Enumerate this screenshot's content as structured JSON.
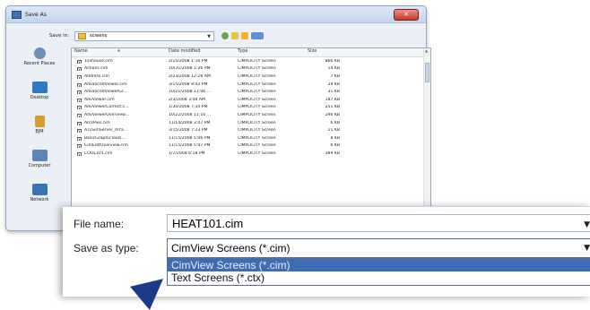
{
  "window": {
    "title": "Save As"
  },
  "save_in": {
    "label": "Save in:",
    "folder": "screens"
  },
  "places": [
    {
      "label": "Recent Places",
      "icon": "recent-places-icon",
      "color": "#6b8fb8"
    },
    {
      "label": "Desktop",
      "icon": "desktop-icon",
      "color": "#2f78c4"
    },
    {
      "label": "BJM",
      "icon": "user-folder-icon",
      "color": "#d79b2e"
    },
    {
      "label": "Computer",
      "icon": "computer-icon",
      "color": "#5c86b8"
    },
    {
      "label": "Network",
      "icon": "network-icon",
      "color": "#3a73b5"
    }
  ],
  "columns": [
    "Name",
    "Date modified",
    "Type",
    "Size"
  ],
  "files": [
    {
      "name": "1sxhouse.cim",
      "date": "2/15/2008 1:16 PM",
      "type": "CIMPLICITY Screen",
      "size": "866 KB"
    },
    {
      "name": "Actions.cim",
      "date": "10/31/2008 1:26 PM",
      "type": "CIMPLICITY Screen",
      "size": "14 KB"
    },
    {
      "name": "Address.cim",
      "date": "2/23/2008 12:28 AM",
      "type": "CIMPLICITY Screen",
      "size": "7 KB"
    },
    {
      "name": "AdvancedViewer.cim",
      "date": "3/15/2008 9:02 PM",
      "type": "CIMPLICITY Screen",
      "size": "29 KB"
    },
    {
      "name": "AdvancedViewerGr...",
      "date": "10/21/2008 11:06 ...",
      "type": "CIMPLICITY Screen",
      "size": "31 KB"
    },
    {
      "name": "AdvViewer.cim",
      "date": "2/3/2008 3:48 AM",
      "type": "CIMPLICITY Screen",
      "size": "187 KB"
    },
    {
      "name": "AdvViewerCorrect.c...",
      "date": "1/30/2008 7:34 PM",
      "type": "CIMPLICITY Screen",
      "size": "251 KB"
    },
    {
      "name": "AdvViewerOverview...",
      "date": "10/22/2008 11:16 ...",
      "type": "CIMPLICITY Screen",
      "size": "296 KB"
    },
    {
      "name": "ArcsPies.cim",
      "date": "11/14/2008 3:47 PM",
      "type": "CIMPLICITY Screen",
      "size": "6 KB"
    },
    {
      "name": "ATLSimServer_Arra...",
      "date": "3/15/2008 7:23 PM",
      "type": "CIMPLICITY Screen",
      "size": "11 KB"
    },
    {
      "name": "BasicGraphicTools....",
      "date": "11/15/2008 5:06 PM",
      "type": "CIMPLICITY Screen",
      "size": "8 KB"
    },
    {
      "name": "CimEditOverview.cim",
      "date": "11/15/2008 5:07 PM",
      "type": "CIMPLICITY Screen",
      "size": "6 KB"
    },
    {
      "name": "COOL101.cim",
      "date": "1/7/2008 6:18 PM",
      "type": "CIMPLICITY Screen",
      "size": "389 KB"
    }
  ],
  "file_name": {
    "label": "File name:",
    "value": "HEAT101.cim"
  },
  "save_as_type": {
    "label": "Save as type:",
    "selected": "CimView Screens (*.cim)",
    "options": [
      "CimView Screens (*.cim)",
      "Text Screens (*.ctx)"
    ]
  }
}
